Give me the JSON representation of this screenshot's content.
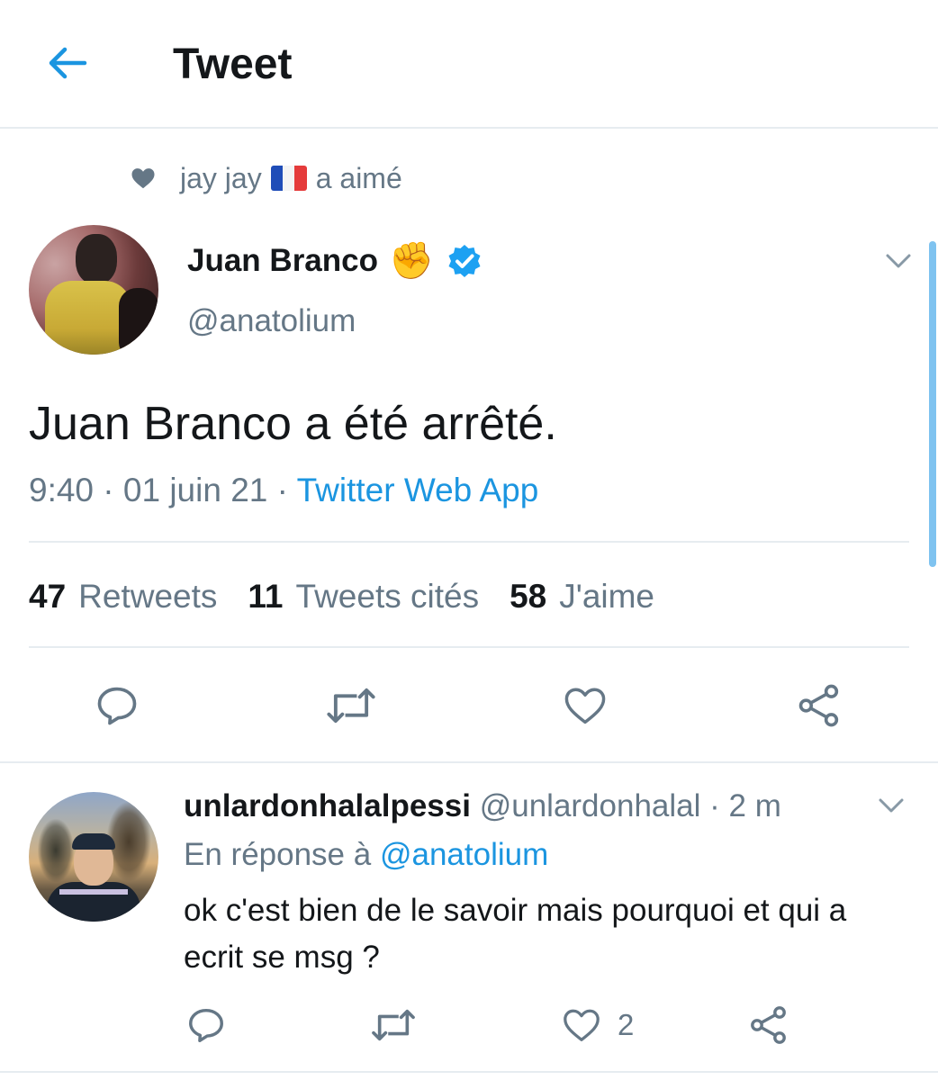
{
  "header": {
    "title": "Tweet",
    "back_icon": "arrow-left-icon"
  },
  "colors": {
    "accent": "#1b95e0",
    "secondary_text": "#657786",
    "divider": "#e6ecf0"
  },
  "social_context": {
    "user": "jay jay",
    "flag": "🇫🇷",
    "action": "a aimé"
  },
  "tweet": {
    "author_name": "Juan Branco",
    "author_emoji": "✊",
    "handle": "@anatolium",
    "text": "Juan Branco a été arrêté.",
    "time": "9:40",
    "date": "01 juin 21",
    "separator": "·",
    "source": "Twitter Web App",
    "stats": {
      "retweets_count": "47",
      "retweets_label": "Retweets",
      "quotes_count": "11",
      "quotes_label": "Tweets cités",
      "likes_count": "58",
      "likes_label": "J'aime"
    }
  },
  "reply": {
    "name": "unlardonhalalpessi",
    "handle": "@unlardonhalal",
    "time": "· 2 m",
    "reply_to_label": "En réponse à",
    "reply_to_mention": "@anatolium",
    "text": "ok c'est bien de le savoir mais pourquoi et qui a ecrit se msg ?",
    "like_count": "2"
  }
}
